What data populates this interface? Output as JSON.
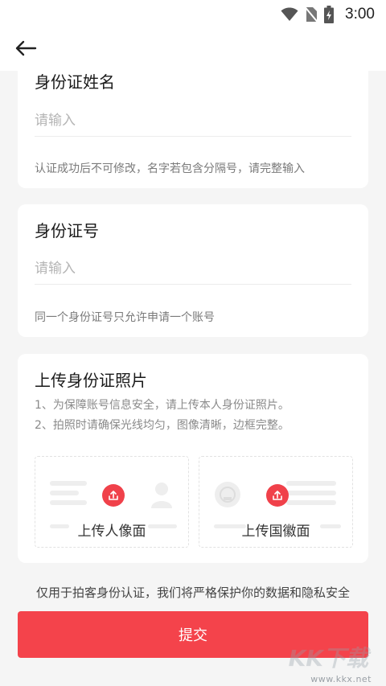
{
  "status_bar": {
    "time": "3:00",
    "icons": [
      "wifi-icon",
      "no-sim-icon",
      "battery-charging-icon"
    ]
  },
  "header": {
    "back_icon": "arrow-left-icon"
  },
  "name_card": {
    "title": "身份证姓名",
    "placeholder": "请输入",
    "hint": "认证成功后不可修改，名字若包含分隔号，请完整输入"
  },
  "id_card": {
    "title": "身份证号",
    "placeholder": "请输入",
    "hint": "同一个身份证号只允许申请一个账号"
  },
  "photo_card": {
    "title": "上传身份证照片",
    "tips": [
      "1、为保障账号信息安全，请上传本人身份证照片。",
      "2、拍照时请确保光线均匀，图像清晰，边框完整。"
    ],
    "front_label": "上传人像面",
    "back_label": "上传国徽面",
    "upload_icon": "upload-icon"
  },
  "privacy_note": "仅用于拍客身份认证，我们将严格保护你的数据和隐私安全",
  "submit_label": "提交",
  "watermark": {
    "logo": "KK下载",
    "url": "www.kkx.net"
  },
  "colors": {
    "accent": "#f4434b",
    "background": "#f5f5f5",
    "card": "#ffffff"
  }
}
